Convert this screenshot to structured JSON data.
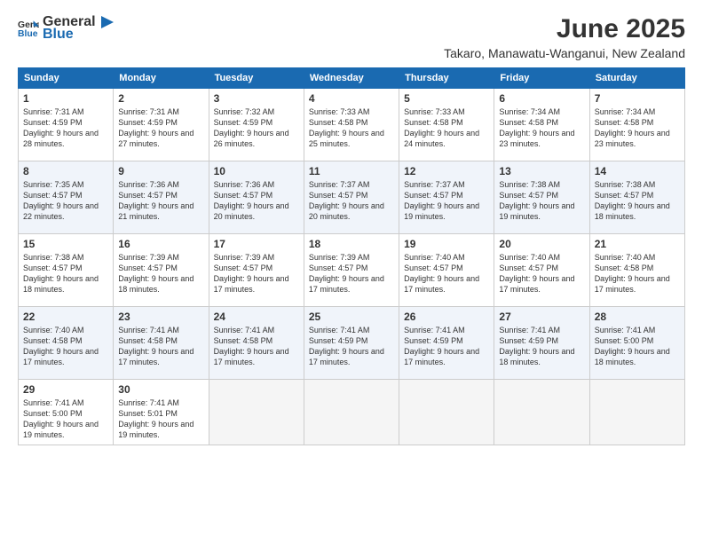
{
  "header": {
    "logo_general": "General",
    "logo_blue": "Blue",
    "month_title": "June 2025",
    "location": "Takaro, Manawatu-Wanganui, New Zealand"
  },
  "days_of_week": [
    "Sunday",
    "Monday",
    "Tuesday",
    "Wednesday",
    "Thursday",
    "Friday",
    "Saturday"
  ],
  "weeks": [
    [
      {
        "day": "1",
        "sunrise": "7:31 AM",
        "sunset": "4:59 PM",
        "daylight": "9 hours and 28 minutes."
      },
      {
        "day": "2",
        "sunrise": "7:31 AM",
        "sunset": "4:59 PM",
        "daylight": "9 hours and 27 minutes."
      },
      {
        "day": "3",
        "sunrise": "7:32 AM",
        "sunset": "4:59 PM",
        "daylight": "9 hours and 26 minutes."
      },
      {
        "day": "4",
        "sunrise": "7:33 AM",
        "sunset": "4:58 PM",
        "daylight": "9 hours and 25 minutes."
      },
      {
        "day": "5",
        "sunrise": "7:33 AM",
        "sunset": "4:58 PM",
        "daylight": "9 hours and 24 minutes."
      },
      {
        "day": "6",
        "sunrise": "7:34 AM",
        "sunset": "4:58 PM",
        "daylight": "9 hours and 23 minutes."
      },
      {
        "day": "7",
        "sunrise": "7:34 AM",
        "sunset": "4:58 PM",
        "daylight": "9 hours and 23 minutes."
      }
    ],
    [
      {
        "day": "8",
        "sunrise": "7:35 AM",
        "sunset": "4:57 PM",
        "daylight": "9 hours and 22 minutes."
      },
      {
        "day": "9",
        "sunrise": "7:36 AM",
        "sunset": "4:57 PM",
        "daylight": "9 hours and 21 minutes."
      },
      {
        "day": "10",
        "sunrise": "7:36 AM",
        "sunset": "4:57 PM",
        "daylight": "9 hours and 20 minutes."
      },
      {
        "day": "11",
        "sunrise": "7:37 AM",
        "sunset": "4:57 PM",
        "daylight": "9 hours and 20 minutes."
      },
      {
        "day": "12",
        "sunrise": "7:37 AM",
        "sunset": "4:57 PM",
        "daylight": "9 hours and 19 minutes."
      },
      {
        "day": "13",
        "sunrise": "7:38 AM",
        "sunset": "4:57 PM",
        "daylight": "9 hours and 19 minutes."
      },
      {
        "day": "14",
        "sunrise": "7:38 AM",
        "sunset": "4:57 PM",
        "daylight": "9 hours and 18 minutes."
      }
    ],
    [
      {
        "day": "15",
        "sunrise": "7:38 AM",
        "sunset": "4:57 PM",
        "daylight": "9 hours and 18 minutes."
      },
      {
        "day": "16",
        "sunrise": "7:39 AM",
        "sunset": "4:57 PM",
        "daylight": "9 hours and 18 minutes."
      },
      {
        "day": "17",
        "sunrise": "7:39 AM",
        "sunset": "4:57 PM",
        "daylight": "9 hours and 17 minutes."
      },
      {
        "day": "18",
        "sunrise": "7:39 AM",
        "sunset": "4:57 PM",
        "daylight": "9 hours and 17 minutes."
      },
      {
        "day": "19",
        "sunrise": "7:40 AM",
        "sunset": "4:57 PM",
        "daylight": "9 hours and 17 minutes."
      },
      {
        "day": "20",
        "sunrise": "7:40 AM",
        "sunset": "4:57 PM",
        "daylight": "9 hours and 17 minutes."
      },
      {
        "day": "21",
        "sunrise": "7:40 AM",
        "sunset": "4:58 PM",
        "daylight": "9 hours and 17 minutes."
      }
    ],
    [
      {
        "day": "22",
        "sunrise": "7:40 AM",
        "sunset": "4:58 PM",
        "daylight": "9 hours and 17 minutes."
      },
      {
        "day": "23",
        "sunrise": "7:41 AM",
        "sunset": "4:58 PM",
        "daylight": "9 hours and 17 minutes."
      },
      {
        "day": "24",
        "sunrise": "7:41 AM",
        "sunset": "4:58 PM",
        "daylight": "9 hours and 17 minutes."
      },
      {
        "day": "25",
        "sunrise": "7:41 AM",
        "sunset": "4:59 PM",
        "daylight": "9 hours and 17 minutes."
      },
      {
        "day": "26",
        "sunrise": "7:41 AM",
        "sunset": "4:59 PM",
        "daylight": "9 hours and 17 minutes."
      },
      {
        "day": "27",
        "sunrise": "7:41 AM",
        "sunset": "4:59 PM",
        "daylight": "9 hours and 18 minutes."
      },
      {
        "day": "28",
        "sunrise": "7:41 AM",
        "sunset": "5:00 PM",
        "daylight": "9 hours and 18 minutes."
      }
    ],
    [
      {
        "day": "29",
        "sunrise": "7:41 AM",
        "sunset": "5:00 PM",
        "daylight": "9 hours and 19 minutes."
      },
      {
        "day": "30",
        "sunrise": "7:41 AM",
        "sunset": "5:01 PM",
        "daylight": "9 hours and 19 minutes."
      },
      null,
      null,
      null,
      null,
      null
    ]
  ]
}
